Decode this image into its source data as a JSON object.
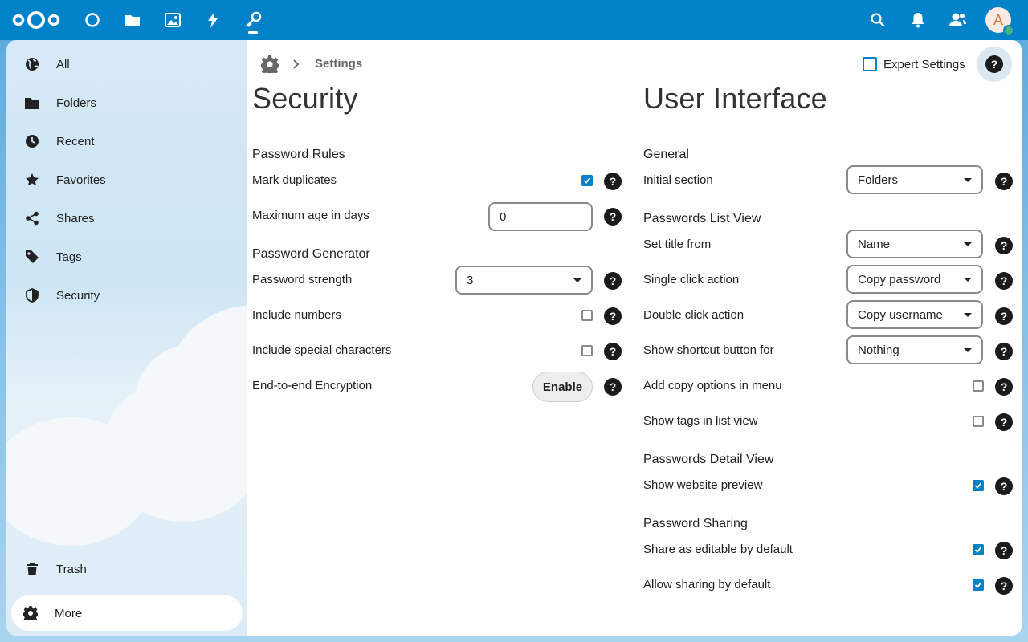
{
  "header": {
    "app_icons": [
      "dashboard-icon",
      "files-icon",
      "photos-icon",
      "activity-icon",
      "passwords-icon"
    ],
    "right_icons": [
      "search-icon",
      "notifications-icon",
      "contacts-icon"
    ],
    "avatar_letter": "A",
    "accent_color": "#0082c9"
  },
  "sidebar": {
    "items": [
      {
        "label": "All",
        "icon": "globe-icon"
      },
      {
        "label": "Folders",
        "icon": "folder-icon"
      },
      {
        "label": "Recent",
        "icon": "clock-icon"
      },
      {
        "label": "Favorites",
        "icon": "star-icon"
      },
      {
        "label": "Shares",
        "icon": "share-icon"
      },
      {
        "label": "Tags",
        "icon": "tag-icon"
      },
      {
        "label": "Security",
        "icon": "shield-icon"
      }
    ],
    "trash_label": "Trash",
    "more_label": "More"
  },
  "breadcrumb": {
    "current": "Settings"
  },
  "expert_settings": {
    "label": "Expert Settings",
    "checked": false
  },
  "security": {
    "title": "Security",
    "password_rules": {
      "heading": "Password Rules",
      "mark_duplicates": {
        "label": "Mark duplicates",
        "checked": true
      },
      "max_age": {
        "label": "Maximum age in days",
        "value": "0"
      }
    },
    "password_generator": {
      "heading": "Password Generator",
      "strength": {
        "label": "Password strength",
        "value": "3"
      },
      "include_numbers": {
        "label": "Include numbers",
        "checked": false
      },
      "include_special": {
        "label": "Include special characters",
        "checked": false
      }
    },
    "e2e": {
      "label": "End-to-end Encryption",
      "button": "Enable"
    }
  },
  "ui": {
    "title": "User Interface",
    "general": {
      "heading": "General",
      "initial_section": {
        "label": "Initial section",
        "value": "Folders"
      }
    },
    "list_view": {
      "heading": "Passwords List View",
      "set_title_from": {
        "label": "Set title from",
        "value": "Name"
      },
      "single_click": {
        "label": "Single click action",
        "value": "Copy password"
      },
      "double_click": {
        "label": "Double click action",
        "value": "Copy username"
      },
      "shortcut_button": {
        "label": "Show shortcut button for",
        "value": "Nothing"
      },
      "copy_options": {
        "label": "Add copy options in menu",
        "checked": false
      },
      "show_tags": {
        "label": "Show tags in list view",
        "checked": false
      }
    },
    "detail_view": {
      "heading": "Passwords Detail View",
      "website_preview": {
        "label": "Show website preview",
        "checked": true
      }
    },
    "sharing": {
      "heading": "Password Sharing",
      "editable_default": {
        "label": "Share as editable by default",
        "checked": true
      },
      "allow_default": {
        "label": "Allow sharing by default",
        "checked": true
      }
    }
  },
  "help_glyph": "?"
}
